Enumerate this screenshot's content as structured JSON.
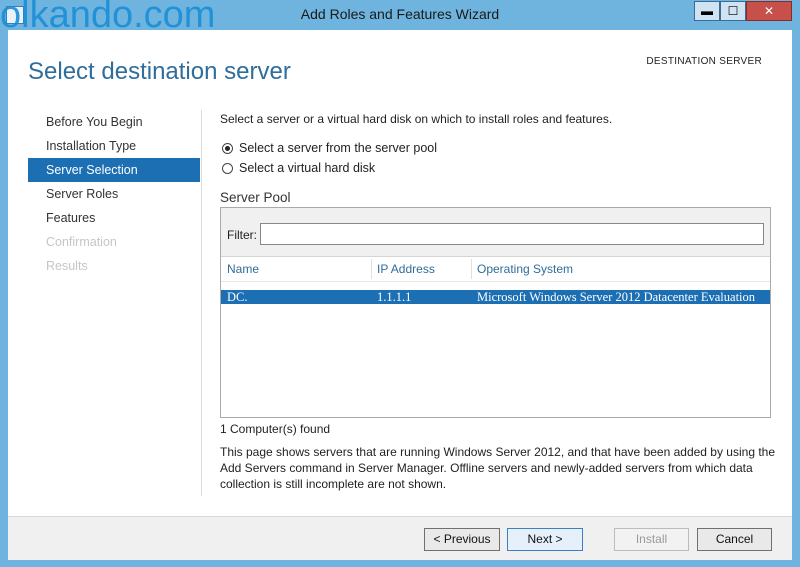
{
  "window": {
    "title": "Add Roles and Features Wizard",
    "watermark": "olkando.com",
    "caption_buttons": {
      "minimize": "▬",
      "maximize": "☐",
      "close": "✕"
    }
  },
  "header": {
    "page_title": "Select destination server",
    "destination_label": "DESTINATION SERVER"
  },
  "sidebar": {
    "items": [
      {
        "label": "Before You Begin",
        "state": "normal"
      },
      {
        "label": "Installation Type",
        "state": "normal"
      },
      {
        "label": "Server Selection",
        "state": "active"
      },
      {
        "label": "Server Roles",
        "state": "normal"
      },
      {
        "label": "Features",
        "state": "normal"
      },
      {
        "label": "Confirmation",
        "state": "disabled"
      },
      {
        "label": "Results",
        "state": "disabled"
      }
    ]
  },
  "main": {
    "intro": "Select a server or a virtual hard disk on which to install roles and features.",
    "options": [
      {
        "label": "Select a server from the server pool",
        "selected": true
      },
      {
        "label": "Select a virtual hard disk",
        "selected": false
      }
    ],
    "pool_title": "Server Pool",
    "filter": {
      "label": "Filter:",
      "value": ""
    },
    "columns": [
      "Name",
      "IP Address",
      "Operating System"
    ],
    "rows": [
      {
        "name": "DC.",
        "ip": "1.1.1.1",
        "os": "Microsoft Windows Server 2012 Datacenter Evaluation",
        "selected": true
      }
    ],
    "found_text": "1 Computer(s) found",
    "note_text": "This page shows servers that are running Windows Server 2012, and that have been added by using the Add Servers command in Server Manager. Offline servers and newly-added servers from which data collection is still incomplete are not shown."
  },
  "footer": {
    "previous": "< Previous",
    "next": "Next >",
    "install": "Install",
    "cancel": "Cancel"
  },
  "colors": {
    "frame": "#6fb3df",
    "accent": "#1c6fb3",
    "title_text": "#2f6d9a"
  }
}
